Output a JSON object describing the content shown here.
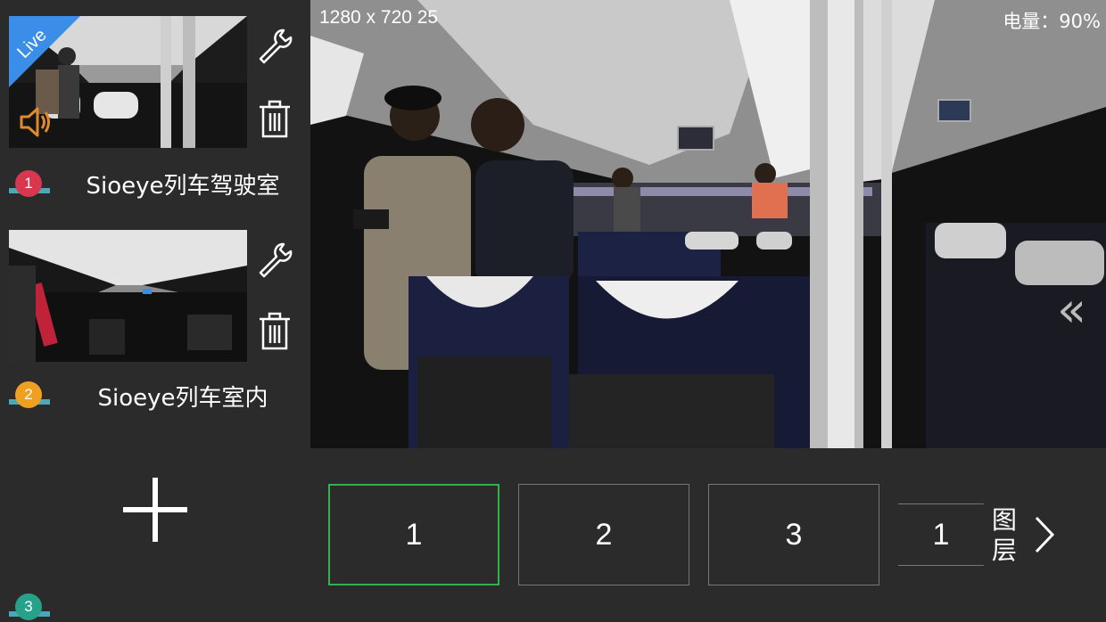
{
  "sources": [
    {
      "index": "1",
      "name": "Sioeye列车驾驶室",
      "live_label": "Live",
      "badge_color": "#d9364f"
    },
    {
      "index": "2",
      "name": "Sioeye列车室内",
      "badge_color": "#f0a020"
    },
    {
      "index": "3",
      "badge_color": "#26a28a"
    }
  ],
  "preview": {
    "resolution_text": "1280 x 720  25",
    "battery_text": "电量：90%",
    "collapse_icon": "double-chevron-left-icon"
  },
  "layers": {
    "items": [
      "1",
      "2",
      "3",
      "1"
    ],
    "active_index": 0,
    "label": "图层",
    "next_icon": "chevron-right-icon"
  },
  "icons": {
    "settings": "wrench-icon",
    "delete": "trash-icon",
    "audio": "speaker-icon",
    "add": "plus-icon"
  },
  "colors": {
    "background": "#2b2b2b",
    "active_border": "#2fb44a",
    "live_ribbon": "#3a8ee8"
  }
}
